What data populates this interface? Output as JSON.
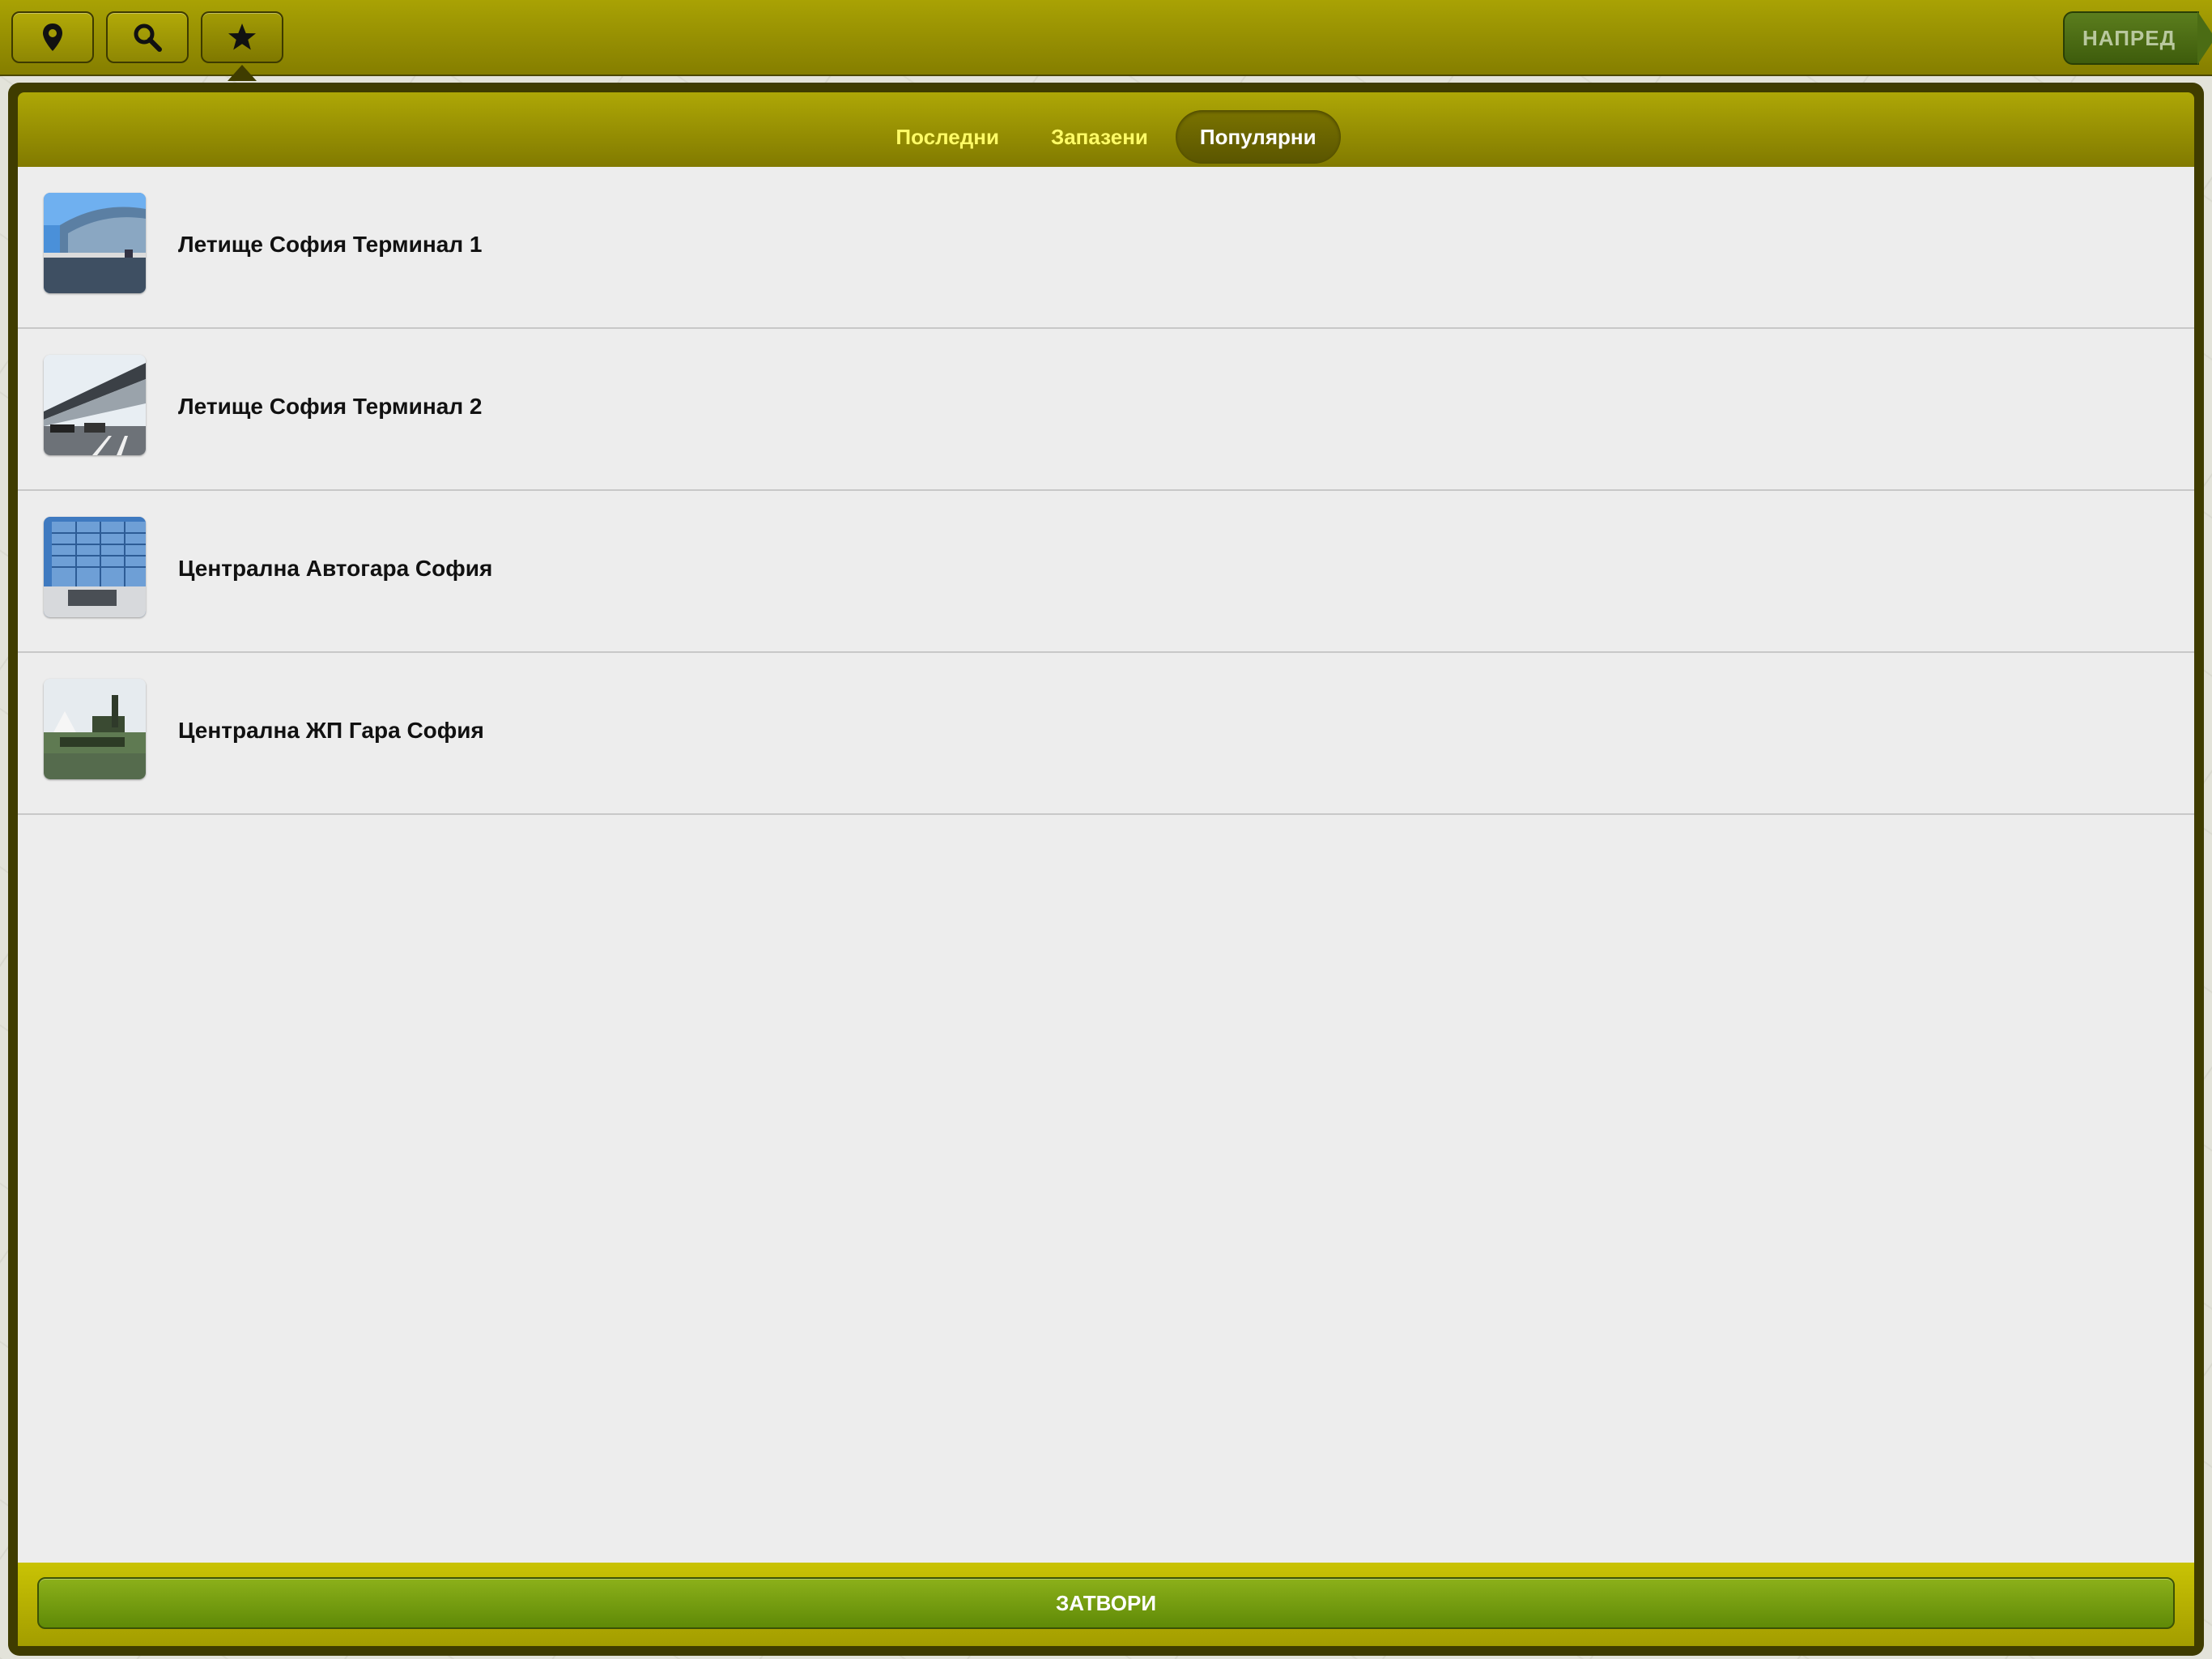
{
  "toolbar": {
    "next_label": "НАПРЕД",
    "icons": [
      "map-pin-icon",
      "search-icon",
      "star-icon"
    ]
  },
  "tabs": [
    {
      "label": "Последни",
      "active": false
    },
    {
      "label": "Запазени",
      "active": false
    },
    {
      "label": "Популярни",
      "active": true
    }
  ],
  "places": [
    {
      "label": "Летище София Терминал 1"
    },
    {
      "label": "Летище София Терминал 2"
    },
    {
      "label": "Централна Автогара София"
    },
    {
      "label": "Централна ЖП Гара София"
    }
  ],
  "footer": {
    "close_label": "ЗАТВОРИ"
  },
  "colors": {
    "bar_olive": "#958e02",
    "tab_text": "#fffb66",
    "close_green": "#76a010",
    "list_bg": "#ededed"
  }
}
